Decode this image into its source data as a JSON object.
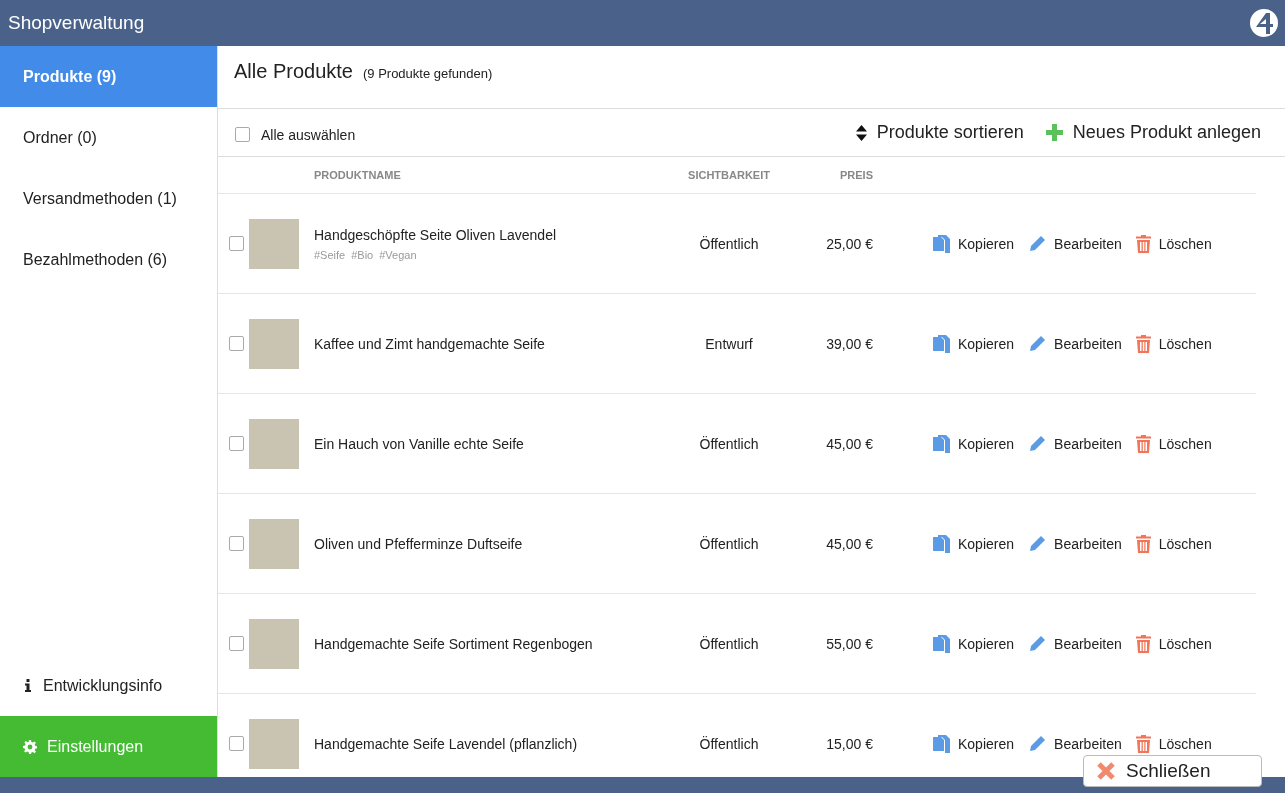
{
  "window": {
    "title": "Shopverwaltung"
  },
  "sidebar": {
    "items": [
      {
        "label": "Produkte (9)",
        "selected": true
      },
      {
        "label": "Ordner (0)",
        "selected": false
      },
      {
        "label": "Versandmethoden (1)",
        "selected": false
      },
      {
        "label": "Bezahlmethoden (6)",
        "selected": false
      }
    ],
    "info": "Entwicklungsinfo",
    "settings": "Einstellungen"
  },
  "page": {
    "title": "Alle Produkte",
    "count": "(9 Produkte gefunden)"
  },
  "toolbar": {
    "select_all": {
      "label": "Alle auswählen",
      "checked": false
    },
    "sort": "Produkte sortieren",
    "new": "Neues Produkt anlegen"
  },
  "table": {
    "columns": [
      "PRODUKTNAME",
      "SICHTBARKEIT",
      "PREIS"
    ],
    "rows": [
      {
        "name": "Handgeschöpfte Seite Oliven Lavendel",
        "tags": [
          "#Seife",
          "#Bio",
          "#Vegan"
        ],
        "visibility": "Öffentlich",
        "price": "25,00 €",
        "checked": false,
        "actions": [
          "Kopieren",
          "Bearbeiten",
          "Löschen"
        ]
      },
      {
        "name": "Kaffee und Zimt handgemachte Seife",
        "tags": [],
        "visibility": "Entwurf",
        "price": "39,00 €",
        "checked": false,
        "actions": [
          "Kopieren",
          "Bearbeiten",
          "Löschen"
        ]
      },
      {
        "name": "Ein Hauch von Vanille echte Seife",
        "tags": [],
        "visibility": "Öffentlich",
        "price": "45,00 €",
        "checked": false,
        "actions": [
          "Kopieren",
          "Bearbeiten",
          "Löschen"
        ]
      },
      {
        "name": "Oliven und Pfefferminze Duftseife",
        "tags": [],
        "visibility": "Öffentlich",
        "price": "45,00 €",
        "checked": false,
        "actions": [
          "Kopieren",
          "Bearbeiten",
          "Löschen"
        ]
      },
      {
        "name": "Handgemachte Seife Sortiment Regenbogen",
        "tags": [],
        "visibility": "Öffentlich",
        "price": "55,00 €",
        "checked": false,
        "actions": [
          "Kopieren",
          "Bearbeiten",
          "Löschen"
        ]
      },
      {
        "name": "Handgemachte Seife Lavendel (pflanzlich)",
        "tags": [],
        "visibility": "Öffentlich",
        "price": "15,00 €",
        "checked": false,
        "actions": [
          "Kopieren",
          "Bearbeiten",
          "Löschen"
        ]
      }
    ]
  },
  "close_button": "Schließen"
}
